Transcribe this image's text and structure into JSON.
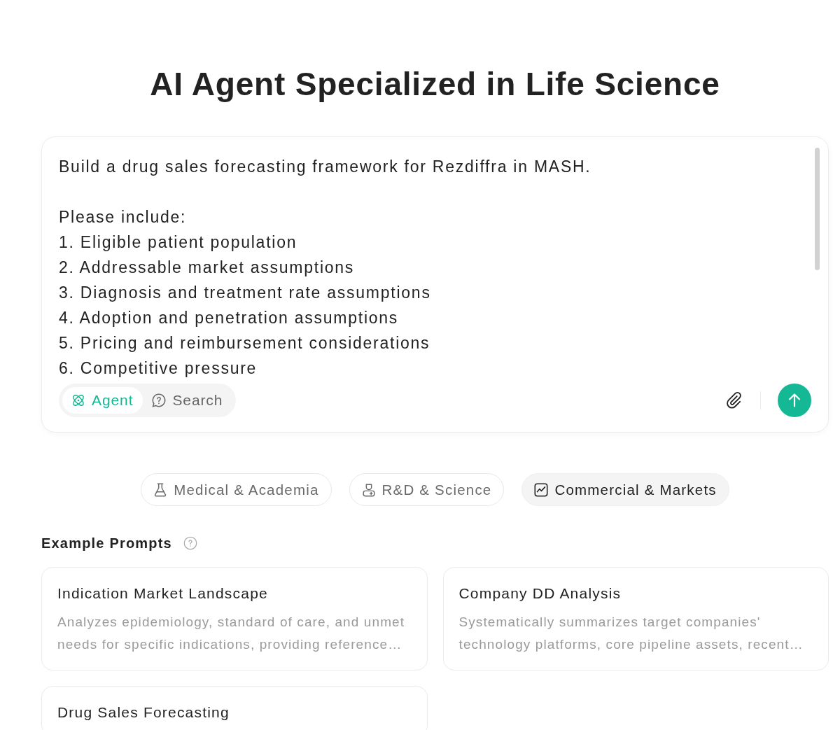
{
  "title": "AI Agent Specialized in Life Science",
  "composer": {
    "value": "Build a drug sales forecasting framework for Rezdiffra in MASH.\n\nPlease include:\n1. Eligible patient population\n2. Addressable market assumptions\n3. Diagnosis and treatment rate assumptions\n4. Adoption and penetration assumptions\n5. Pricing and reimbursement considerations\n6. Competitive pressure",
    "modes": [
      {
        "label": "Agent",
        "selected": true
      },
      {
        "label": "Search",
        "selected": false
      }
    ]
  },
  "categories": [
    {
      "label": "Medical & Academia",
      "selected": false
    },
    {
      "label": "R&D & Science",
      "selected": false
    },
    {
      "label": "Commercial & Markets",
      "selected": true
    }
  ],
  "example_prompts": {
    "heading": "Example Prompts",
    "cards": [
      {
        "title": "Indication Market Landscape",
        "description": "Analyzes epidemiology, standard of care, and unmet needs for specific indications, providing reference…"
      },
      {
        "title": "Company DD Analysis",
        "description": "Systematically summarizes target companies' technology platforms, core pipeline assets, recent…"
      },
      {
        "title": "Drug Sales Forecasting"
      }
    ]
  }
}
